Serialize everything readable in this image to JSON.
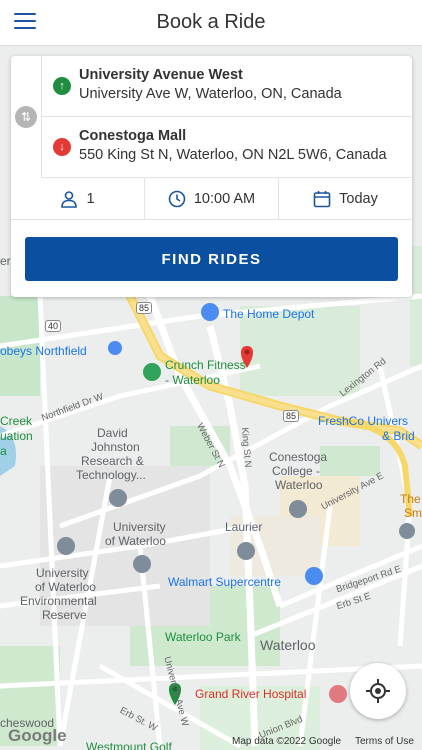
{
  "header": {
    "title": "Book a Ride",
    "menu_icon": "hamburger-menu-icon"
  },
  "trip": {
    "from": {
      "name": "University Avenue West",
      "address": "University Ave W, Waterloo, ON, Canada",
      "icon": "arrow-up-icon",
      "color": "#1e8e3e"
    },
    "to": {
      "name": "Conestoga Mall",
      "address": "550 King St N, Waterloo, ON N2L 5W6, Canada",
      "icon": "arrow-down-icon",
      "color": "#e53935"
    },
    "passengers": "1",
    "time": "10:00 AM",
    "date": "Today",
    "find_label": "FIND RIDES"
  },
  "map": {
    "labels": {
      "home_depot": "The Home Depot",
      "crunch_1": "Crunch Fitness",
      "crunch_2": "- Waterloo",
      "zehrs": "obeys Northfield",
      "freshco_1": "FreshCo Univers",
      "freshco_2": "& Brid",
      "creek_1": "Creek",
      "creek_2": "uation",
      "creek_3": "a",
      "dj_1": "David",
      "dj_2": "Johnston",
      "dj_3": "Research &",
      "dj_4": "Technology...",
      "conestoga_1": "Conestoga",
      "conestoga_2": "College -",
      "conestoga_3": "Waterloo",
      "uw_1": "University",
      "uw_2": "of Waterloo",
      "uwer_1": "University",
      "uwer_2": "of Waterloo",
      "uwer_3": "Environmental",
      "uwer_4": "Reserve",
      "laurier_1": "Laurier",
      "walmart": "Walmart Supercentre",
      "waterloo_park": "Waterloo Park",
      "waterloo": "Waterloo",
      "grand_river": "Grand River Hospital",
      "cheswood": "cheswood",
      "westmount": "Westmount Golf",
      "the_1": "The",
      "the_2": "Sm",
      "bersal": "er",
      "northfield_dr": "Northfield Dr W",
      "weber": "Weber St N",
      "king": "King St N",
      "lexington": "Lexington Rd",
      "university_ave_e": "University Ave E",
      "bridgeport": "Bridgeport Rd E",
      "erb_e": "Erb St E",
      "erb_w": "Erb St. W",
      "union": "Union Blvd",
      "univ_ave_w": "University Ave W",
      "hwy85_a": "85",
      "hwy85_b": "85",
      "r40": "40"
    },
    "attribution": "Map data ©2022 Google",
    "terms": "Terms of Use",
    "logo": "Google"
  },
  "colors": {
    "primary": "#0a4fa0",
    "accent": "#1a56a0",
    "green": "#1e8e3e",
    "red": "#e53935"
  }
}
